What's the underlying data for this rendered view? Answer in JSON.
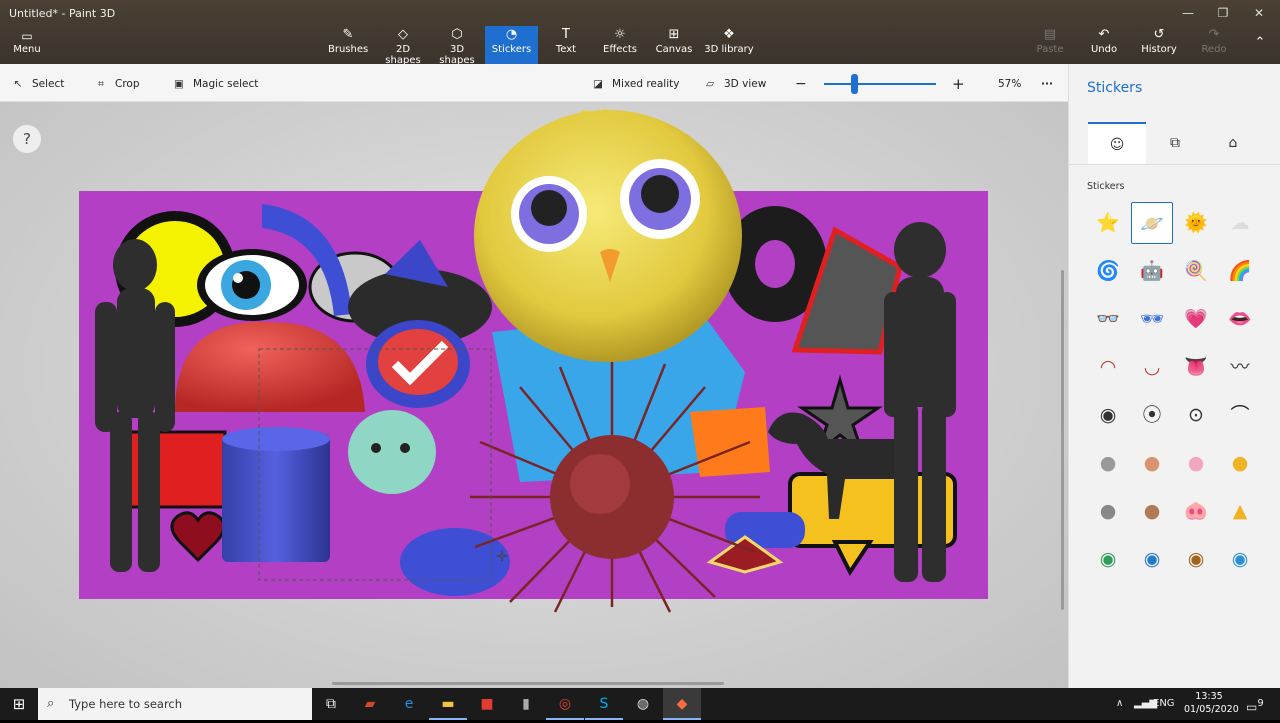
{
  "window": {
    "title": "Untitled* - Paint 3D",
    "controls": [
      "—",
      "❐",
      "✕"
    ]
  },
  "ribbon": {
    "menu": {
      "label": "Menu",
      "icon": "folder-icon"
    },
    "tools": [
      {
        "label": "Brushes",
        "icon": "brush-icon"
      },
      {
        "label": "2D shapes",
        "icon": "2d-shapes-icon"
      },
      {
        "label": "3D shapes",
        "icon": "3d-shapes-icon"
      },
      {
        "label": "Stickers",
        "icon": "stickers-icon",
        "active": true
      },
      {
        "label": "Text",
        "icon": "text-icon"
      },
      {
        "label": "Effects",
        "icon": "effects-icon"
      },
      {
        "label": "Canvas",
        "icon": "canvas-icon"
      },
      {
        "label": "3D library",
        "icon": "3d-library-icon"
      }
    ],
    "actions": [
      {
        "label": "Paste",
        "icon": "paste-icon",
        "enabled": false
      },
      {
        "label": "Undo",
        "icon": "undo-icon",
        "enabled": true
      },
      {
        "label": "History",
        "icon": "history-icon",
        "enabled": true
      },
      {
        "label": "Redo",
        "icon": "redo-icon",
        "enabled": false
      }
    ]
  },
  "toolbar": {
    "select": "Select",
    "crop": "Crop",
    "magic_select": "Magic select",
    "mixed_reality": "Mixed reality",
    "view_3d": "3D view",
    "zoom": "57%",
    "zoom_level": 0.57,
    "more": "···"
  },
  "canvas": {
    "background": "#b23fc4",
    "objects": [
      "figure",
      "sticker",
      "sticker",
      "3d-shape",
      "3d-shape",
      "chick",
      "sea-urchin",
      "dog",
      "figure",
      "sticker",
      "sticker"
    ]
  },
  "panel": {
    "title": "Stickers",
    "tabs": [
      {
        "icon": "sticker-face-icon",
        "active": true
      },
      {
        "icon": "textures-icon",
        "active": false
      },
      {
        "icon": "open-folder-icon",
        "active": false
      }
    ],
    "section_label": "Stickers",
    "stickers": [
      {
        "icon": "star-face-sticker",
        "glyph": "⭐"
      },
      {
        "icon": "planet-sticker",
        "glyph": "🪐",
        "selected": true
      },
      {
        "icon": "sun-sticker",
        "glyph": "🌞"
      },
      {
        "icon": "cloud-sticker",
        "glyph": "☁"
      },
      {
        "icon": "spiral-sticker",
        "glyph": "🌀"
      },
      {
        "icon": "robot-sticker",
        "glyph": "🤖"
      },
      {
        "icon": "lollipop-sticker",
        "glyph": "🍭"
      },
      {
        "icon": "rainbow-sticker",
        "glyph": "🌈"
      },
      {
        "icon": "glasses-sticker",
        "glyph": "👓"
      },
      {
        "icon": "sunglasses-sticker",
        "glyph": "🕶"
      },
      {
        "icon": "heart-sticker",
        "glyph": "💗"
      },
      {
        "icon": "lips-sticker",
        "glyph": "👄"
      },
      {
        "icon": "mouth-sad-sticker",
        "glyph": "◠"
      },
      {
        "icon": "mouth-smile-sticker",
        "glyph": "◡"
      },
      {
        "icon": "mouth-tongue-sticker",
        "glyph": "👅"
      },
      {
        "icon": "mustache-sticker",
        "glyph": "〰"
      },
      {
        "icon": "eye-round-sticker",
        "glyph": "◉"
      },
      {
        "icon": "eye-look-up-sticker",
        "glyph": "⦿"
      },
      {
        "icon": "eye-look-down-sticker",
        "glyph": "⊙"
      },
      {
        "icon": "eyebrow-sticker",
        "glyph": "⌒"
      },
      {
        "icon": "nose-grey-sticker",
        "glyph": "●"
      },
      {
        "icon": "nose-tan-sticker",
        "glyph": "●"
      },
      {
        "icon": "ear-pink-sticker",
        "glyph": "●"
      },
      {
        "icon": "ear-yellow-sticker",
        "glyph": "●"
      },
      {
        "icon": "snout-grey-sticker",
        "glyph": "●"
      },
      {
        "icon": "snout-dog-sticker",
        "glyph": "●"
      },
      {
        "icon": "snout-pig-sticker",
        "glyph": "🐽"
      },
      {
        "icon": "beak-sticker",
        "glyph": "▲"
      },
      {
        "icon": "eye-green-sticker",
        "glyph": "◉"
      },
      {
        "icon": "eye-blue-sticker",
        "glyph": "◉"
      },
      {
        "icon": "eye-orange-sticker",
        "glyph": "◉"
      },
      {
        "icon": "eye-lash-sticker",
        "glyph": "◉"
      }
    ],
    "sticker_colors": [
      "#f3c623",
      "#2aa3a8",
      "#f3b623",
      "#ddd",
      "#333",
      "#c0392b",
      "#8e44ad",
      "#e67e22",
      "#333",
      "#3a6fd8",
      "#e7327c",
      "#d73737",
      "#c0392b",
      "#c0392b",
      "#e75a7c",
      "#333",
      "#333",
      "#333",
      "#333",
      "#222",
      "#999",
      "#d8956d",
      "#f2a6c0",
      "#f0b323",
      "#888",
      "#b07a55",
      "#f19cb7",
      "#f0b323",
      "#2e9e5a",
      "#2478d1",
      "#a1621c",
      "#2a90d4"
    ]
  },
  "taskbar": {
    "search_placeholder": "Type here to search",
    "apps": [
      {
        "icon": "task-view-icon",
        "glyph": "⧉",
        "state": "none"
      },
      {
        "icon": "office-icon",
        "glyph": "▰",
        "state": "none",
        "color": "#d24726"
      },
      {
        "icon": "edge-icon",
        "glyph": "e",
        "state": "none",
        "color": "#1f8fe0"
      },
      {
        "icon": "file-explorer-icon",
        "glyph": "▬",
        "state": "open",
        "color": "#f5c342"
      },
      {
        "icon": "ms-store-icon",
        "glyph": "■",
        "state": "none",
        "color": "#e03c31"
      },
      {
        "icon": "usb-drive-icon",
        "glyph": "▮",
        "state": "none",
        "color": "#aaa"
      },
      {
        "icon": "chrome-icon",
        "glyph": "◎",
        "state": "open",
        "color": "#ea4335"
      },
      {
        "icon": "skype-icon",
        "glyph": "S",
        "state": "open",
        "color": "#00aff0"
      },
      {
        "icon": "camera-app-icon",
        "glyph": "◍",
        "state": "none",
        "color": "#ddd"
      },
      {
        "icon": "paint3d-icon",
        "glyph": "◆",
        "state": "active",
        "color": "#ff6a3d"
      }
    ],
    "tray_arrow": "∧",
    "network_icon": "network-icon",
    "volume_icon": "volume-icon",
    "language": "ENG",
    "time": "13:35",
    "date": "01/05/2020",
    "notifications": "9"
  }
}
